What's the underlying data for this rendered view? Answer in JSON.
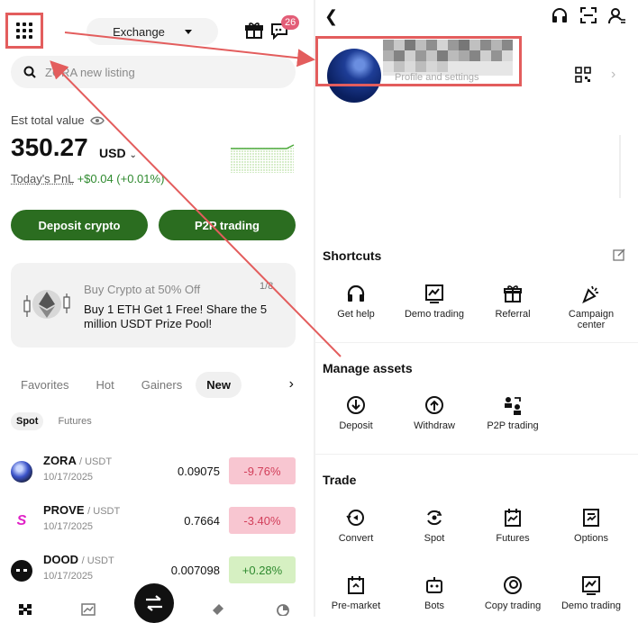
{
  "left": {
    "header": {
      "exchange_label": "Exchange",
      "badge_count": "26"
    },
    "search": {
      "placeholder": "ZORA new listing"
    },
    "account": {
      "est_label": "Est total value",
      "balance": "350.27",
      "unit": "USD",
      "pnl_label": "Today's PnL",
      "pnl_value": "+$0.04 (+0.01%)"
    },
    "actions": {
      "deposit": "Deposit crypto",
      "p2p": "P2P trading"
    },
    "promo": {
      "title": "Buy Crypto at 50% Off",
      "body": "Buy 1 ETH Get 1 Free! Share the 5 million USDT Prize Pool!",
      "counter": "1/8"
    },
    "tabs": [
      "Favorites",
      "Hot",
      "Gainers",
      "New"
    ],
    "subtabs": [
      "Spot",
      "Futures"
    ],
    "rows": [
      {
        "symbol": "ZORA",
        "quote": "/ USDT",
        "date": "10/17/2025",
        "price": "0.09075",
        "change": "-9.76%",
        "dir": "neg"
      },
      {
        "symbol": "PROVE",
        "quote": "/ USDT",
        "date": "10/17/2025",
        "price": "0.7664",
        "change": "-3.40%",
        "dir": "neg"
      },
      {
        "symbol": "DOOD",
        "quote": "/ USDT",
        "date": "10/17/2025",
        "price": "0.007098",
        "change": "+0.28%",
        "dir": "pos"
      }
    ]
  },
  "right": {
    "profile": {
      "subtitle": "Profile and settings"
    },
    "shortcuts": {
      "title": "Shortcuts",
      "items": [
        "Get help",
        "Demo trading",
        "Referral",
        "Campaign center"
      ]
    },
    "manage": {
      "title": "Manage assets",
      "items": [
        "Deposit",
        "Withdraw",
        "P2P trading"
      ]
    },
    "trade": {
      "title": "Trade",
      "items": [
        "Convert",
        "Spot",
        "Futures",
        "Options",
        "Pre-market",
        "Bots",
        "Copy trading",
        "Demo trading"
      ]
    }
  },
  "colors": {
    "accent_green": "#2b6d20",
    "annotation_red": "#e35d5d",
    "negative": "#d23f5a",
    "positive": "#2f8a2f"
  }
}
